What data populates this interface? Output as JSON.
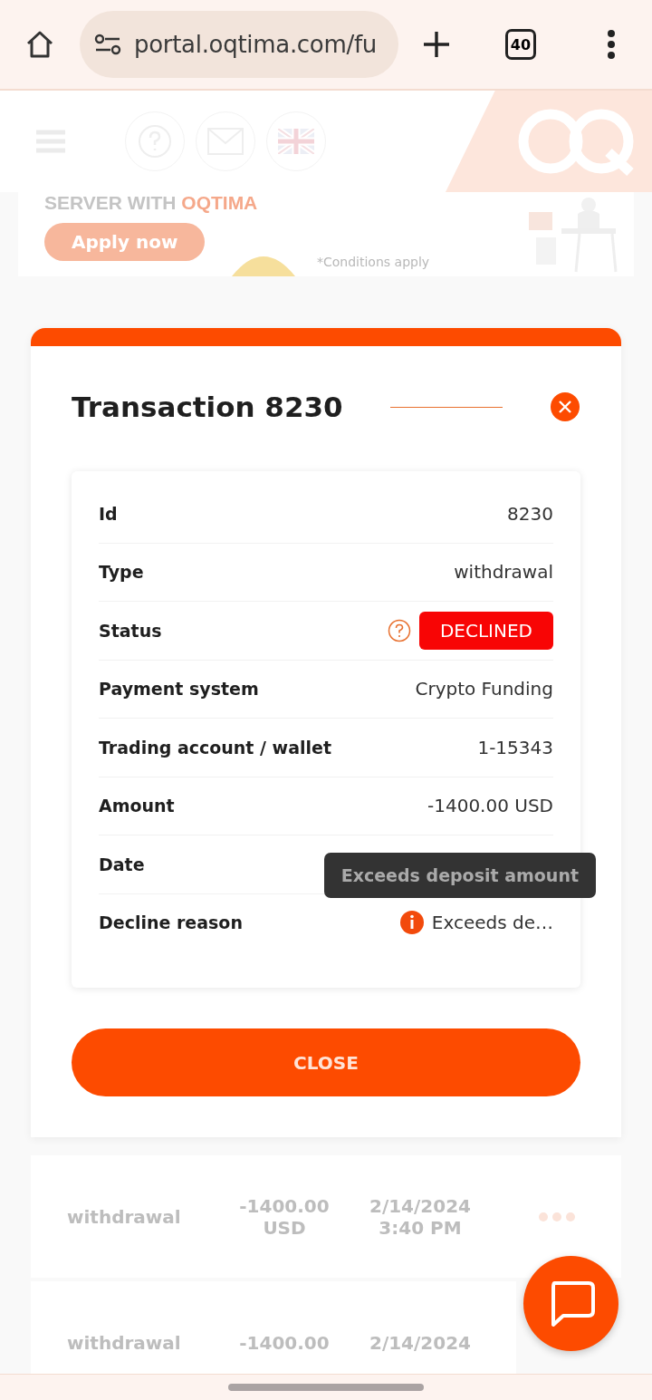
{
  "browser": {
    "url": "portal.oqtima.com/fu",
    "tab_count": "40"
  },
  "banner": {
    "headline": "SERVER WITH ",
    "headline_brand": "OQTIMA",
    "button": "Apply now",
    "note": "*Conditions apply"
  },
  "modal": {
    "title": "Transaction 8230",
    "details": [
      {
        "label": "Id",
        "kind": "text",
        "value": "8230"
      },
      {
        "label": "Type",
        "kind": "text",
        "value": "withdrawal"
      },
      {
        "label": "Status",
        "kind": "status",
        "value": "DECLINED"
      },
      {
        "label": "Payment system",
        "kind": "text",
        "value": "Crypto Funding"
      },
      {
        "label": "Trading account / wallet",
        "kind": "text",
        "value": "1-15343"
      },
      {
        "label": "Amount",
        "kind": "text",
        "value": "-1400.00 USD"
      },
      {
        "label": "Date",
        "kind": "covered"
      },
      {
        "label": "Decline reason",
        "kind": "reason",
        "value": "Exceeds de…",
        "tooltip": "Exceeds deposit amount"
      }
    ],
    "button": "CLOSE"
  },
  "table": {
    "rows": [
      {
        "type": "withdrawal",
        "amount": [
          "-1400.00",
          "USD"
        ],
        "date": [
          "2/14/2024",
          "3:40 PM"
        ]
      },
      {
        "type": "withdrawal",
        "amount": [
          "-1400.00"
        ],
        "date": [
          "2/14/2024"
        ]
      }
    ]
  }
}
